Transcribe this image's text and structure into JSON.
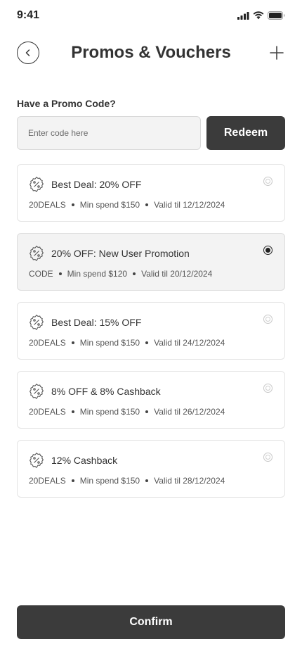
{
  "status_bar": {
    "time": "9:41",
    "icons": [
      "signal-icon",
      "wifi-icon",
      "battery-icon"
    ]
  },
  "header": {
    "title": "Promos & Vouchers",
    "back_icon": "chevron-left-icon",
    "add_icon": "plus-icon"
  },
  "promo": {
    "label": "Have a Promo Code?",
    "placeholder": "Enter code here",
    "value": "",
    "redeem_label": "Redeem"
  },
  "vouchers": [
    {
      "title": "Best Deal: 20% OFF",
      "code": "20DEALS",
      "min_spend": "Min spend $150",
      "valid": "Valid til 12/12/2024",
      "selected": false
    },
    {
      "title": "20% OFF: New User Promotion",
      "code": "CODE",
      "min_spend": "Min spend $120",
      "valid": "Valid til 20/12/2024",
      "selected": true
    },
    {
      "title": "Best Deal: 15% OFF",
      "code": "20DEALS",
      "min_spend": "Min spend $150",
      "valid": "Valid til 24/12/2024",
      "selected": false
    },
    {
      "title": "8% OFF & 8% Cashback",
      "code": "20DEALS",
      "min_spend": "Min spend $150",
      "valid": "Valid til 26/12/2024",
      "selected": false
    },
    {
      "title": "12% Cashback",
      "code": "20DEALS",
      "min_spend": "Min spend $150",
      "valid": "Valid til 28/12/2024",
      "selected": false
    }
  ],
  "voucher_icon": "percent-badge-icon",
  "confirm_label": "Confirm",
  "colors": {
    "primary_button": "#3b3b3b",
    "selected_card_bg": "#f3f3f3",
    "text": "#333333"
  }
}
